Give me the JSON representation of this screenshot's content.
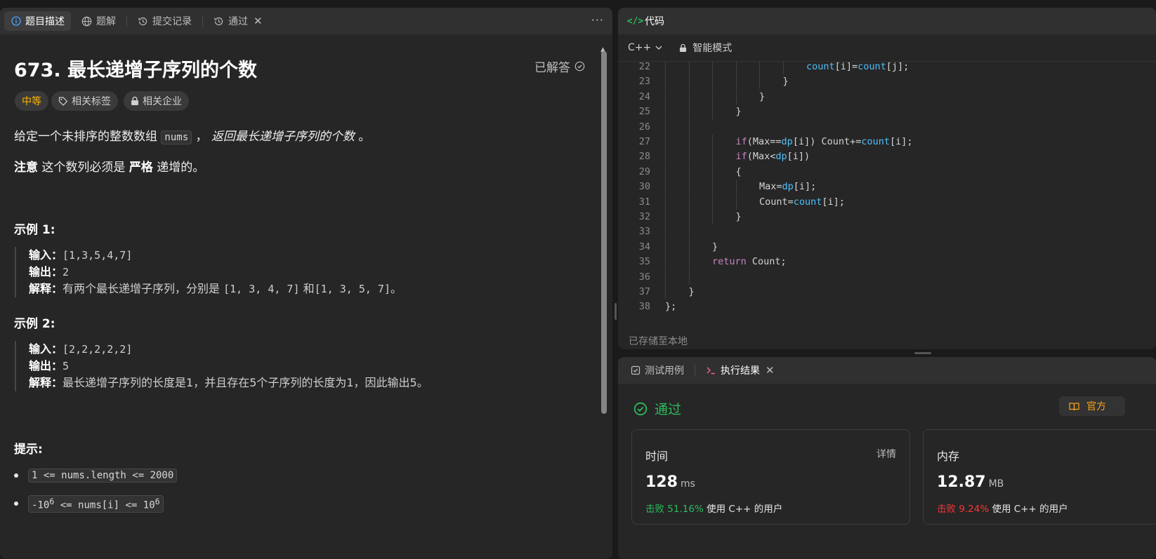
{
  "left_tabs": [
    {
      "label": "题目描述",
      "icon": "info-icon"
    },
    {
      "label": "题解",
      "icon": "globe-icon"
    },
    {
      "label": "提交记录",
      "icon": "history-icon"
    },
    {
      "label": "通过",
      "icon": "clock-icon"
    }
  ],
  "problem": {
    "title": "673. 最长递增子序列的个数",
    "solved_label": "已解答",
    "difficulty": "中等",
    "tags_label": "相关标签",
    "companies_label": "相关企业",
    "desc_prefix": "给定一个未排序的整数数组",
    "desc_code": "nums",
    "desc_sep": "，",
    "desc_emph": "返回最长递增子序列的个数",
    "desc_end": "。",
    "note_bold": "注意",
    "note_mid": "这个数列必须是",
    "note_bold2": "严格",
    "note_end": "递增的。",
    "examples": [
      {
        "heading": "示例 1:",
        "input_label": "输入：",
        "input": "[1,3,5,4,7]",
        "output_label": "输出：",
        "output": "2",
        "explain_label": "解释：",
        "explain_a": "有两个最长递增子序列，分别是",
        "explain_b": "[1, 3, 4, 7]",
        "explain_c": "和",
        "explain_d": "[1, 3, 5, 7]",
        "explain_e": "。"
      },
      {
        "heading": "示例 2:",
        "input_label": "输入：",
        "input": "[2,2,2,2,2]",
        "output_label": "输出：",
        "output": "5",
        "explain_label": "解释：",
        "explain_a": "最长递增子序列的长度是1，并且存在5个子序列的长度为1，因此输出5。"
      }
    ],
    "hints_heading": "提示:",
    "constraint1": "1 <= nums.length <= 2000",
    "constraint2_a": "-10",
    "constraint2_sup1": "6",
    "constraint2_b": " <= nums[i] <= 10",
    "constraint2_sup2": "6"
  },
  "code_panel": {
    "tab_label": "代码",
    "language": "C++",
    "mode_label": "智能模式",
    "saved_status": "已存储至本地",
    "lines": [
      {
        "n": "22",
        "indent": 6,
        "parts": [
          [
            "fn",
            "count"
          ],
          [
            "",
            "[i]="
          ],
          [
            "fn",
            "count"
          ],
          [
            "",
            "[j];"
          ]
        ]
      },
      {
        "n": "23",
        "indent": 5,
        "parts": [
          [
            "",
            "}"
          ]
        ]
      },
      {
        "n": "24",
        "indent": 4,
        "parts": [
          [
            "",
            "}"
          ]
        ]
      },
      {
        "n": "25",
        "indent": 3,
        "parts": [
          [
            "",
            "}"
          ]
        ]
      },
      {
        "n": "26",
        "indent": 0,
        "parts": []
      },
      {
        "n": "27",
        "indent": 3,
        "parts": [
          [
            "kw",
            "if"
          ],
          [
            "",
            "(Max=="
          ],
          [
            "fn",
            "dp"
          ],
          [
            "",
            "[i]) Count+="
          ],
          [
            "fn",
            "count"
          ],
          [
            "",
            "[i];"
          ]
        ]
      },
      {
        "n": "28",
        "indent": 3,
        "parts": [
          [
            "kw",
            "if"
          ],
          [
            "",
            "(Max<"
          ],
          [
            "fn",
            "dp"
          ],
          [
            "",
            "[i])"
          ]
        ]
      },
      {
        "n": "29",
        "indent": 3,
        "parts": [
          [
            "",
            "{"
          ]
        ]
      },
      {
        "n": "30",
        "indent": 4,
        "parts": [
          [
            "",
            "Max="
          ],
          [
            "fn",
            "dp"
          ],
          [
            "",
            "[i];"
          ]
        ]
      },
      {
        "n": "31",
        "indent": 4,
        "parts": [
          [
            "",
            "Count="
          ],
          [
            "fn",
            "count"
          ],
          [
            "",
            "[i];"
          ]
        ]
      },
      {
        "n": "32",
        "indent": 3,
        "parts": [
          [
            "",
            "}"
          ]
        ]
      },
      {
        "n": "33",
        "indent": 0,
        "parts": []
      },
      {
        "n": "34",
        "indent": 2,
        "parts": [
          [
            "",
            "}"
          ]
        ]
      },
      {
        "n": "35",
        "indent": 2,
        "parts": [
          [
            "kw",
            "return"
          ],
          [
            "",
            " Count;"
          ]
        ]
      },
      {
        "n": "36",
        "indent": 0,
        "parts": []
      },
      {
        "n": "37",
        "indent": 1,
        "parts": [
          [
            "",
            "}"
          ]
        ]
      },
      {
        "n": "38",
        "indent": 0,
        "parts": [
          [
            "",
            "};"
          ]
        ]
      }
    ]
  },
  "result_panel": {
    "tabs": [
      {
        "label": "测试用例",
        "icon": "checkbox-icon"
      },
      {
        "label": "执行结果",
        "icon": "terminal-icon"
      }
    ],
    "status": "通过",
    "official_label": "官方",
    "runtime": {
      "label": "时间",
      "details": "详情",
      "value": "128",
      "unit": "ms",
      "beat": "击败 51.16%",
      "beat_suffix": "使用 C++ 的用户"
    },
    "memory": {
      "label": "内存",
      "value": "12.87",
      "unit": "MB",
      "beat": "击败 9.24%",
      "beat_suffix": "使用 C++ 的用户"
    }
  },
  "colors": {
    "accent_green": "#2cbb5d",
    "accent_orange": "#ffa116",
    "beat_red": "#f63636",
    "difficulty": "#ffb800"
  }
}
